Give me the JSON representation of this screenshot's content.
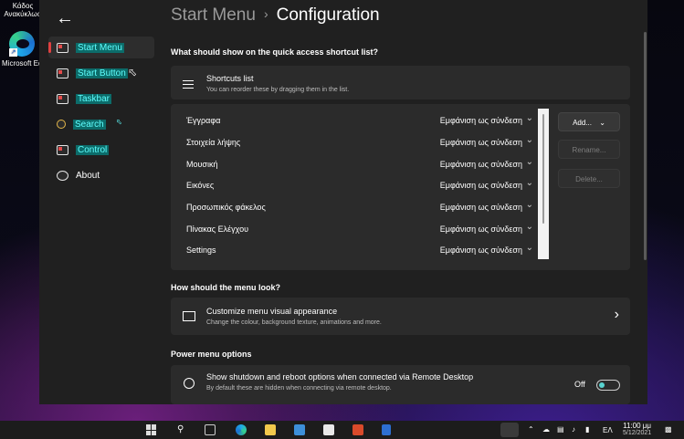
{
  "desktop": {
    "recycle_bin_label_1": "Κάδος",
    "recycle_bin_label_2": "Ανακύκλωσ",
    "edge_label": "Microsoft Ed"
  },
  "nav": {
    "items": [
      {
        "label": "Start Menu",
        "icon": "start-menu-icon"
      },
      {
        "label": "Start Button",
        "icon": "start-button-icon"
      },
      {
        "label": "Taskbar",
        "icon": "taskbar-icon"
      },
      {
        "label": "Search",
        "icon": "search-icon"
      },
      {
        "label": "Control",
        "icon": "control-icon"
      },
      {
        "label": "About",
        "icon": "info-icon"
      }
    ]
  },
  "header": {
    "parent": "Start Menu",
    "separator": "›",
    "current": "Configuration"
  },
  "shortcuts_section": {
    "title": "What should show on the quick access shortcut list?",
    "card_title": "Shortcuts list",
    "card_subtitle": "You can reorder these by dragging them in the list.",
    "items": [
      {
        "name": "Έγγραφα",
        "mode": "Εμφάνιση ως σύνδεση"
      },
      {
        "name": "Στοιχεία λήψης",
        "mode": "Εμφάνιση ως σύνδεση"
      },
      {
        "name": "Μουσική",
        "mode": "Εμφάνιση ως σύνδεση"
      },
      {
        "name": "Εικόνες",
        "mode": "Εμφάνιση ως σύνδεση"
      },
      {
        "name": "Προσωπικός φάκελος",
        "mode": "Εμφάνιση ως σύνδεση"
      },
      {
        "name": "Πίνακας Ελέγχου",
        "mode": "Εμφάνιση ως σύνδεση"
      },
      {
        "name": "Settings",
        "mode": "Εμφάνιση ως σύνδεση"
      }
    ],
    "add_label": "Add...",
    "rename_label": "Rename...",
    "delete_label": "Delete..."
  },
  "look_section": {
    "title": "How should the menu look?",
    "card_title": "Customize menu visual appearance",
    "card_subtitle": "Change the colour, background texture, animations and more."
  },
  "power_section": {
    "title": "Power menu options",
    "card_title": "Show shutdown and reboot options when connected via Remote Desktop",
    "card_subtitle": "By default these are hidden when connecting via remote desktop.",
    "toggle_state": "Off"
  },
  "taskbar": {
    "language": "ΕΛ",
    "time": "11:00 μμ",
    "date": "5/12/2021"
  },
  "colors": {
    "accent": "#58d3d0",
    "selection_marker": "#e04040",
    "window_bg": "#202020",
    "card_bg": "#2b2b2b"
  }
}
